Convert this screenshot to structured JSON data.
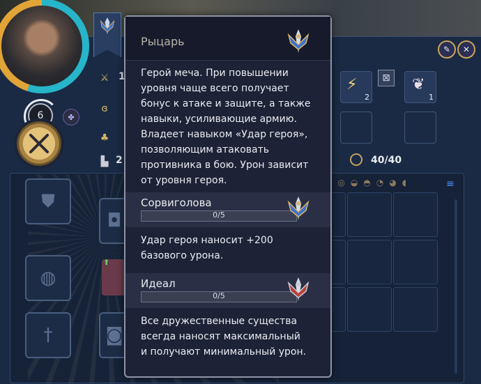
{
  "hero": {
    "level": "6",
    "stats": {
      "attack": "1",
      "defense": "2",
      "supply": "40/40"
    }
  },
  "slots": {
    "skill_count_1": "2",
    "skill_count_2": "1"
  },
  "tooltip": {
    "title": "Рыцарь",
    "description": [
      "Герой меча. При повышении",
      "уровня чаще всего получает",
      "бонус к атаке и защите, а также",
      "навыки, усиливающие армию.",
      "Владеет навыком «Удар героя»,",
      "позволяющим атаковать",
      "противника в бою. Урон зависит",
      "от уровня героя."
    ],
    "sections": [
      {
        "title": "Сорвиголова",
        "progress_label": "0/5",
        "progress_fraction": 0,
        "lines": [
          "Удар героя наносит +200",
          "базового урона."
        ]
      },
      {
        "title": "Идеал",
        "progress_label": "0/5",
        "progress_fraction": 0,
        "lines": [
          "Все дружественные существа",
          "всегда наносят максимальный",
          "и получают минимальный урон."
        ]
      }
    ]
  },
  "icons": {
    "sword_crest": "sword-crest-icon",
    "sword_crest_red": "sword-crest-red-icon"
  },
  "colors": {
    "gold": "#e0a437",
    "teal": "#26b5c9",
    "tooltip_bg": "#1e2236"
  }
}
